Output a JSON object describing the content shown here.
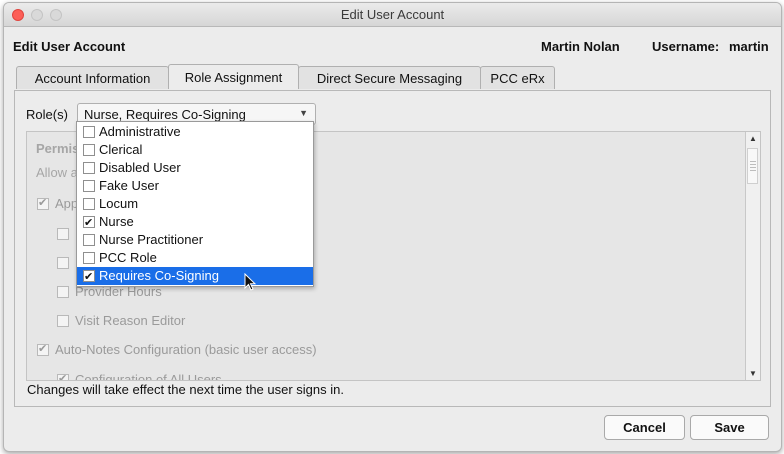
{
  "window": {
    "title": "Edit User Account"
  },
  "header": {
    "title": "Edit User Account",
    "user_name": "Martin  Nolan",
    "username_label": "Username:",
    "username_value": "martin"
  },
  "tabs": [
    {
      "label": "Account Information"
    },
    {
      "label": "Role Assignment"
    },
    {
      "label": "Direct Secure Messaging"
    },
    {
      "label": "PCC eRx"
    }
  ],
  "roles": {
    "label": "Role(s)",
    "selected_value": "Nurse, Requires Co-Signing",
    "options": [
      {
        "label": "Administrative",
        "checked": false
      },
      {
        "label": "Clerical",
        "checked": false
      },
      {
        "label": "Disabled User",
        "checked": false
      },
      {
        "label": "Fake User",
        "checked": false
      },
      {
        "label": "Locum",
        "checked": false
      },
      {
        "label": "Nurse",
        "checked": true
      },
      {
        "label": "Nurse Practitioner",
        "checked": false
      },
      {
        "label": "PCC Role",
        "checked": false
      },
      {
        "label": "Requires Co-Signing",
        "checked": true,
        "highlighted": true
      }
    ]
  },
  "permissions": {
    "title": "Permis",
    "subtitle": "Allow a",
    "items": [
      {
        "label": "App",
        "checked": true
      },
      {
        "label": "",
        "checked": false
      },
      {
        "label": "",
        "checked": false
      },
      {
        "label": "Provider Hours",
        "checked": false
      },
      {
        "label": "Visit Reason Editor",
        "checked": false
      },
      {
        "label": "Auto-Notes Configuration (basic user access)",
        "checked": true
      },
      {
        "label": "Configuration of All Users",
        "checked": true
      }
    ]
  },
  "footer": {
    "note": "Changes will take effect the next time the user signs in.",
    "cancel_label": "Cancel",
    "save_label": "Save"
  },
  "colors": {
    "selection": "#1a6ee8",
    "close_button": "#fc5f57"
  }
}
